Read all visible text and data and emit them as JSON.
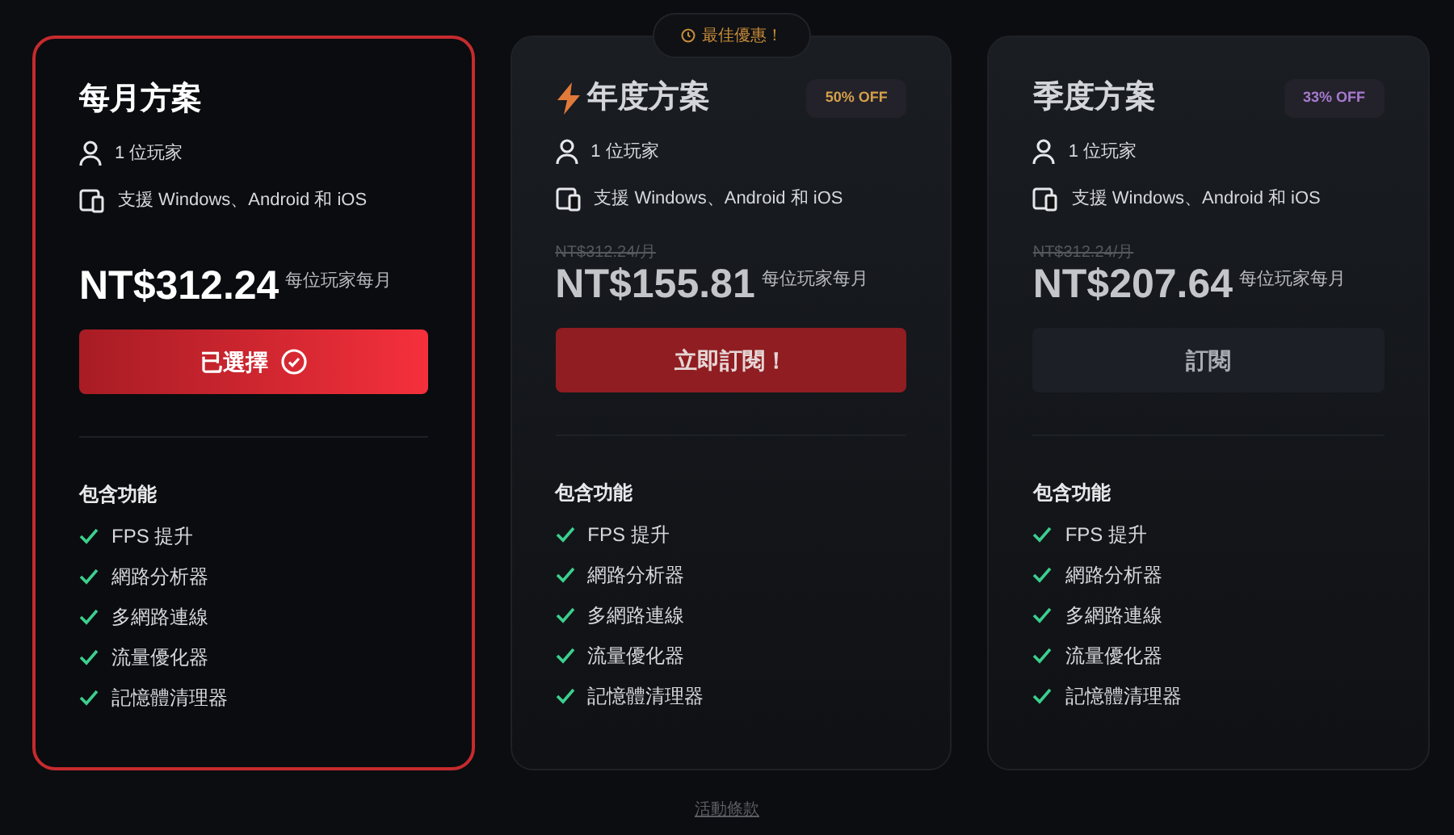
{
  "plans": [
    {
      "title": "每月方案",
      "selected": true,
      "featured": false,
      "players": "1 位玩家",
      "platforms": "支援 Windows、Android 和 iOS",
      "price": "NT$312.24",
      "unit": "每位玩家每月",
      "button": {
        "label": "已選擇",
        "kind": "chosen"
      },
      "features_title": "包含功能",
      "features": [
        "FPS 提升",
        "網路分析器",
        "多網路連線",
        "流量優化器",
        "記憶體清理器"
      ]
    },
    {
      "title": "年度方案",
      "selected": false,
      "featured": true,
      "tag": "最佳優惠！",
      "discount": {
        "label": "50% OFF",
        "color": "#d4a04a"
      },
      "old_price": "NT$312.24/月",
      "players": "1 位玩家",
      "platforms": "支援 Windows、Android 和 iOS",
      "price": "NT$155.81",
      "unit": "每位玩家每月",
      "button": {
        "label": "立即訂閱！",
        "kind": "primary"
      },
      "features_title": "包含功能",
      "features": [
        "FPS 提升",
        "網路分析器",
        "多網路連線",
        "流量優化器",
        "記憶體清理器"
      ]
    },
    {
      "title": "季度方案",
      "selected": false,
      "featured": false,
      "discount": {
        "label": "33% OFF",
        "color": "#a77bd0"
      },
      "old_price": "NT$312.24/月",
      "players": "1 位玩家",
      "platforms": "支援 Windows、Android 和 iOS",
      "price": "NT$207.64",
      "unit": "每位玩家每月",
      "button": {
        "label": "訂閱",
        "kind": "secondary"
      },
      "features_title": "包含功能",
      "features": [
        "FPS 提升",
        "網路分析器",
        "多網路連線",
        "流量優化器",
        "記憶體清理器"
      ]
    }
  ],
  "footer_link": "活動條款"
}
